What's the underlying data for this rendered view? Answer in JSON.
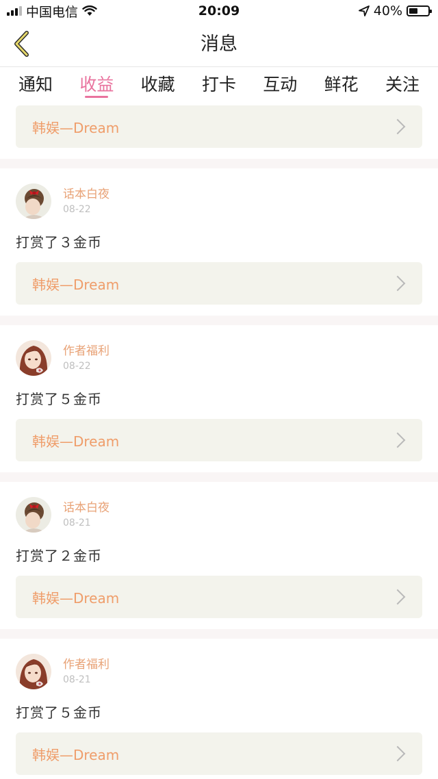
{
  "status_bar": {
    "carrier": "中国电信",
    "time": "20:09",
    "battery": "40%"
  },
  "nav": {
    "title": "消息"
  },
  "tabs": [
    {
      "label": "通知"
    },
    {
      "label": "收益",
      "active": true
    },
    {
      "label": "收藏"
    },
    {
      "label": "打卡"
    },
    {
      "label": "互动"
    },
    {
      "label": "鲜花"
    },
    {
      "label": "关注"
    }
  ],
  "top_ref": {
    "label": "韩娱—Dream"
  },
  "messages": [
    {
      "name": "话本白夜",
      "date": "08-22",
      "text": "打赏了３金币",
      "ref": "韩娱—Dream",
      "avatar": "girl-red-bow"
    },
    {
      "name": "作者福利",
      "date": "08-22",
      "text": "打赏了５金币",
      "ref": "韩娱—Dream",
      "avatar": "anime-girl"
    },
    {
      "name": "话本白夜",
      "date": "08-21",
      "text": "打赏了２金币",
      "ref": "韩娱—Dream",
      "avatar": "girl-red-bow"
    },
    {
      "name": "作者福利",
      "date": "08-21",
      "text": "打赏了５金币",
      "ref": "韩娱—Dream",
      "avatar": "anime-girl"
    }
  ],
  "colors": {
    "accent": "#e9739e",
    "ref_text": "#ef9d6a",
    "name": "#e8a276",
    "card_bg": "#f3f3ec"
  }
}
